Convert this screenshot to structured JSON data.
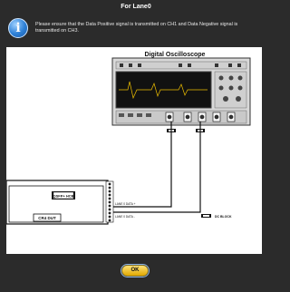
{
  "dialog": {
    "title": "For Lane0",
    "message": "Please ensure that the Data Positive signal is transmitted on CH1 and Data Negative signal is transmitted on CH3.",
    "ok_label": "OK"
  },
  "diagram": {
    "scope_label": "Digital Oscilloscope",
    "fixture_label": "QSFP+ HCB",
    "dut_label": "CR4 DUT",
    "cable_label_1": "LANE 0 DATA +",
    "cable_label_2": "LANE 0 DATA -",
    "legend_label": "DC BLOCK"
  }
}
